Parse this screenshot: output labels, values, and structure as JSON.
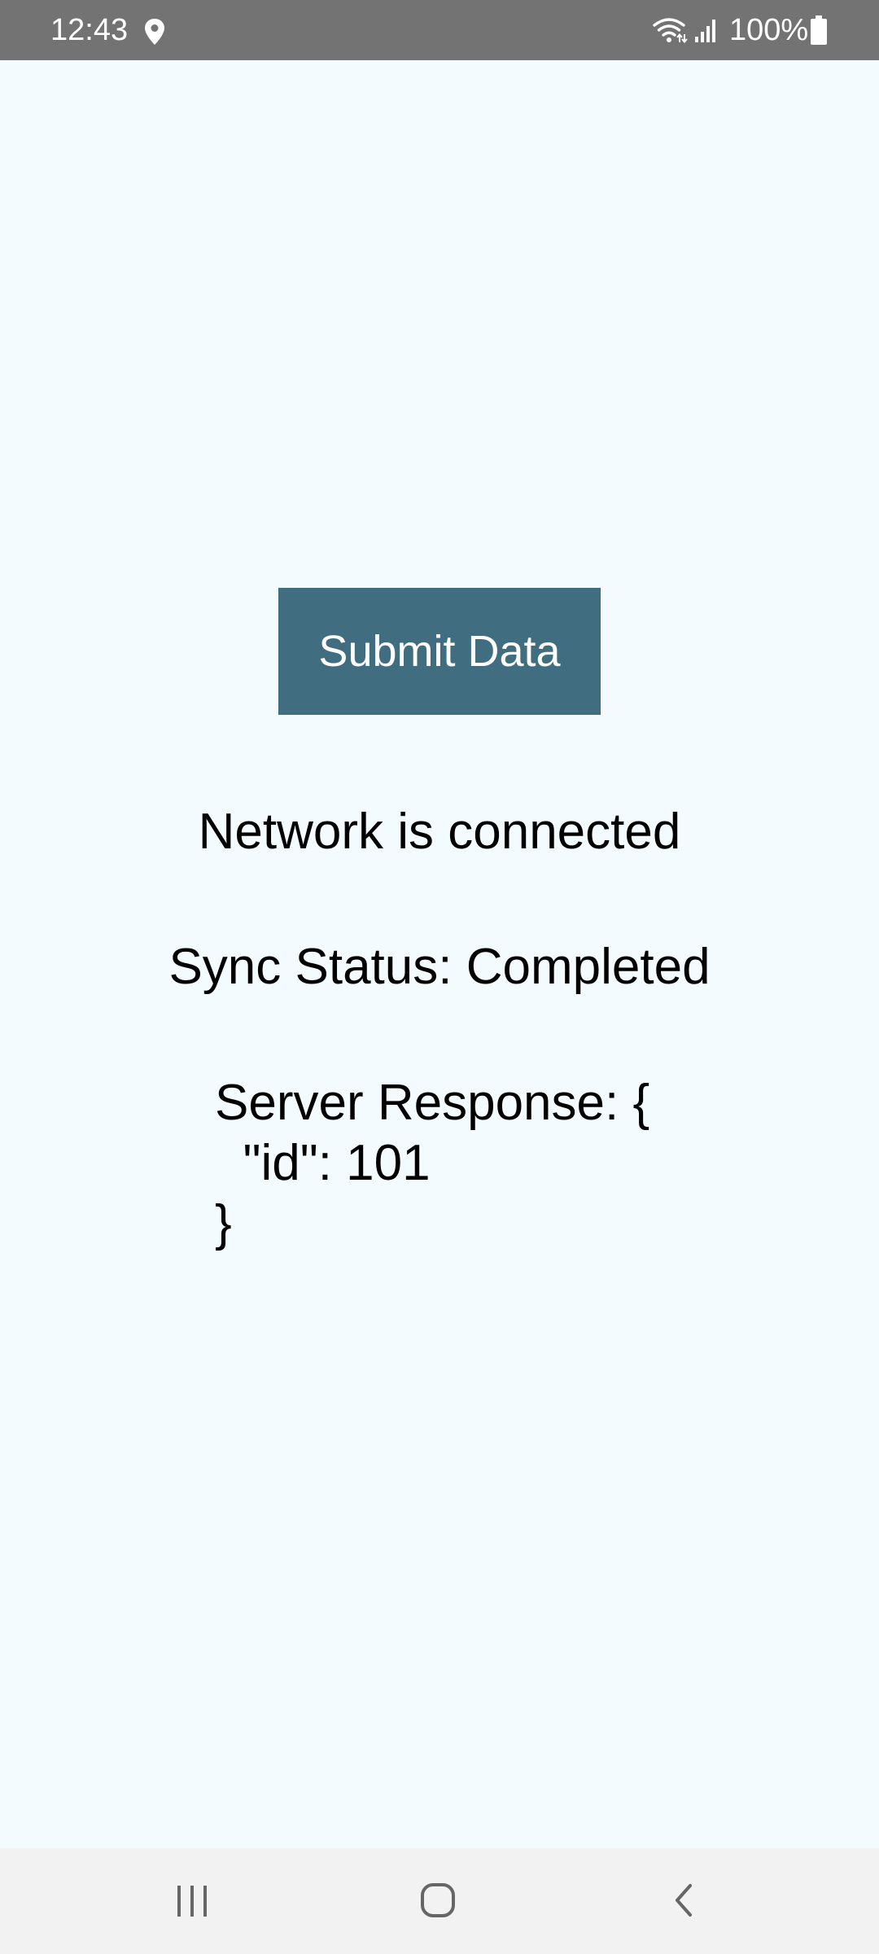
{
  "status_bar": {
    "time": "12:43",
    "battery": "100%",
    "icons": [
      "location-icon",
      "wifi-icon",
      "signal-icon",
      "battery-icon"
    ]
  },
  "main": {
    "submit_button_label": "Submit Data",
    "network_status": "Network is connected",
    "sync_status": "Sync Status: Completed",
    "server_response": "Server Response: {\n  \"id\": 101\n}"
  },
  "nav_bar": {
    "icons": [
      "recents-icon",
      "home-icon",
      "back-icon"
    ]
  },
  "colors": {
    "background": "#f3fbfe",
    "button": "#416d80",
    "status_bar": "#737373",
    "nav_bar": "#f2f2f2"
  }
}
